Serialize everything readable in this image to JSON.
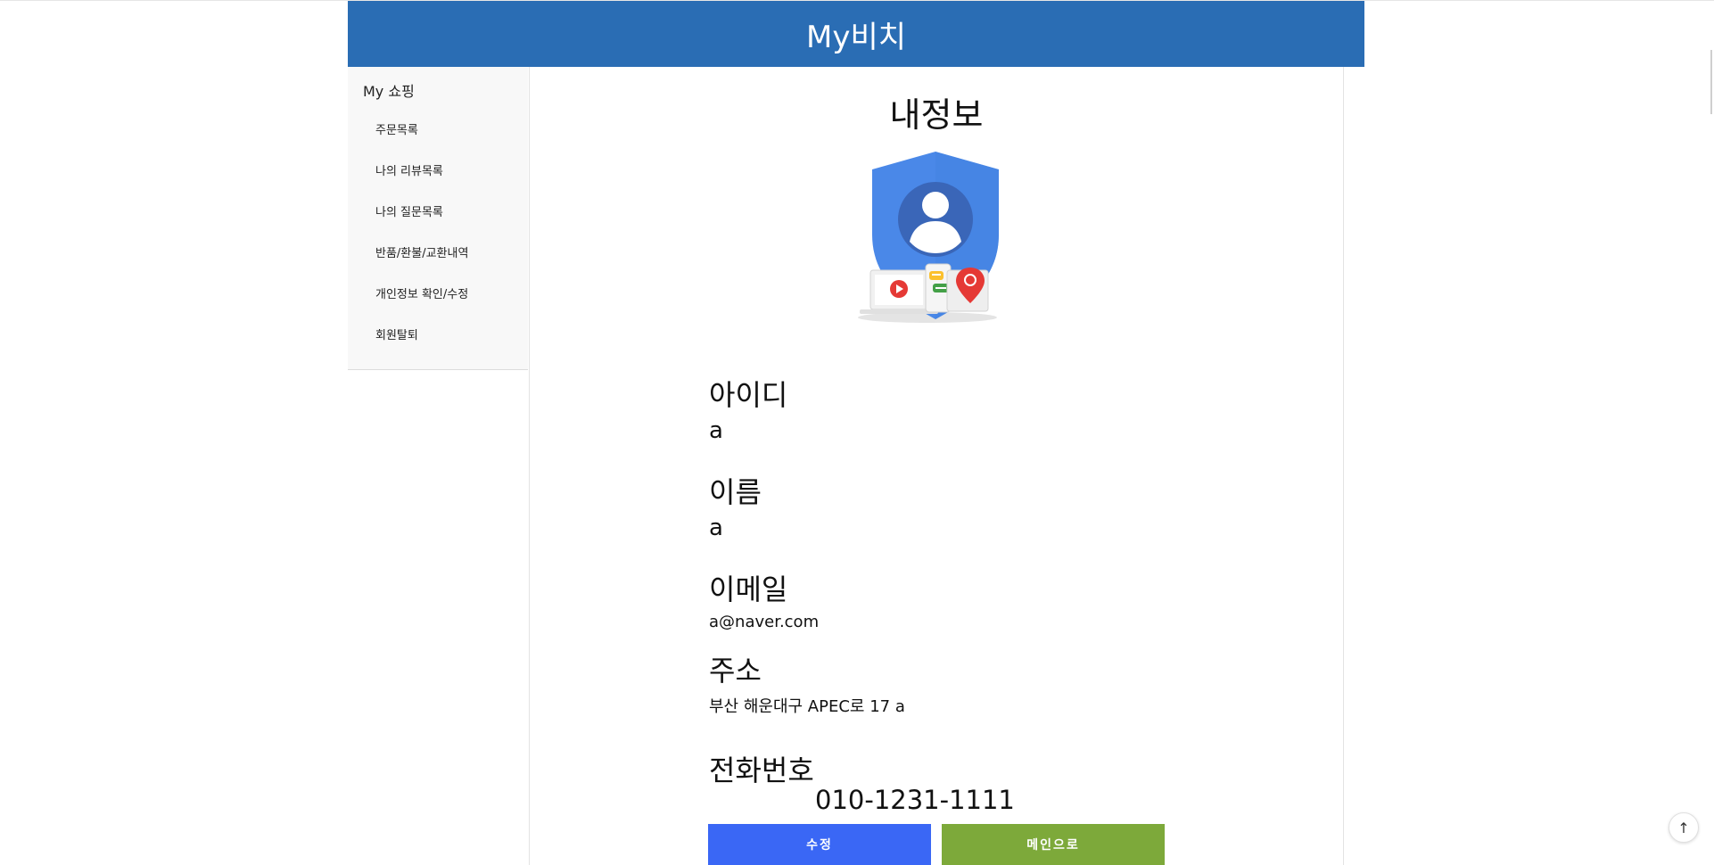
{
  "header": {
    "title": "My비치"
  },
  "sidebar": {
    "title": "My 쇼핑",
    "items": [
      {
        "label": "주문목록"
      },
      {
        "label": "나의 리뷰목록"
      },
      {
        "label": "나의 질문목록"
      },
      {
        "label": "반품/환불/교환내역"
      },
      {
        "label": "개인정보 확인/수정"
      },
      {
        "label": "회원탈퇴"
      }
    ]
  },
  "main": {
    "title": "내정보",
    "fields": {
      "id": {
        "label": "아이디",
        "value": "a"
      },
      "name": {
        "label": "이름",
        "value": "a"
      },
      "email": {
        "label": "이메일",
        "value": "a@naver.com"
      },
      "address": {
        "label": "주소",
        "value": "부산 해운대구 APEC로 17 a"
      },
      "phone": {
        "label": "전화번호",
        "value": "010-1231-1111"
      }
    },
    "buttons": {
      "edit": "수정",
      "main": "메인으로"
    }
  },
  "colors": {
    "header_bg": "#2a6db4",
    "edit_button": "#3a67f5",
    "main_button": "#7da93a"
  },
  "icons": {
    "profile": "account-shield-illustration",
    "scroll_top": "arrow-up-icon"
  }
}
